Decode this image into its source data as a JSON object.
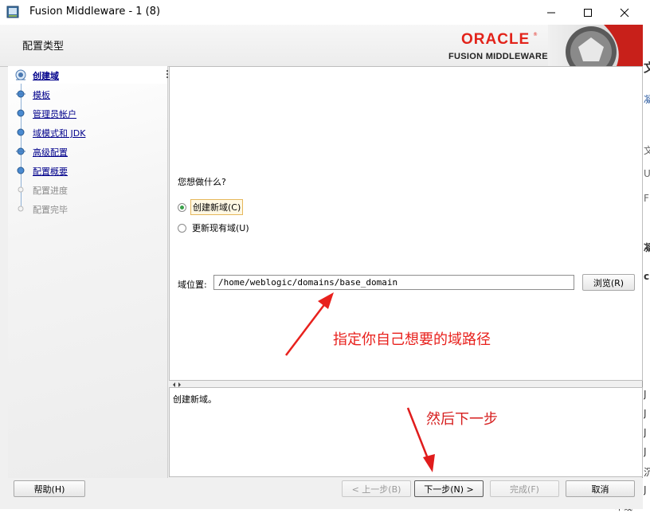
{
  "window": {
    "title": "Fusion Middleware  -  1 (8)"
  },
  "header": {
    "title": "配置类型",
    "brand": "ORACLE",
    "brand_sub": "FUSION MIDDLEWARE",
    "brand_reg": "®"
  },
  "nav": {
    "items": [
      {
        "label": "创建域",
        "state": "active"
      },
      {
        "label": "模板",
        "state": "link"
      },
      {
        "label": "管理员帐户",
        "state": "link"
      },
      {
        "label": "域模式和 JDK",
        "state": "link"
      },
      {
        "label": "高级配置",
        "state": "link"
      },
      {
        "label": "配置概要",
        "state": "link"
      },
      {
        "label": "配置进度",
        "state": "disabled"
      },
      {
        "label": "配置完毕",
        "state": "disabled"
      }
    ]
  },
  "main": {
    "question": "您想做什么?",
    "options": [
      {
        "label": "创建新域(C)",
        "checked": true
      },
      {
        "label": "更新现有域(U)",
        "checked": false
      }
    ],
    "domain_location_label": "域位置:",
    "domain_location_value": "/home/weblogic/domains/base_domain",
    "browse_label": "浏览(R)"
  },
  "description": {
    "text": "创建新域。"
  },
  "footer": {
    "help": "帮助(H)",
    "back": "< 上一步(B)",
    "next": "下一步(N) >",
    "finish": "完成(F)",
    "cancel": "取消"
  },
  "annotations": {
    "domain_path_note": "指定你自己想要的域路径",
    "next_note": "然后下一步"
  },
  "background": {
    "right_edge_chars": [
      "文",
      "凝",
      "文",
      "U",
      "F",
      "凝",
      "c",
      "J",
      "J",
      "J",
      "J",
      "沉",
      "J"
    ],
    "bottom_text": "本线"
  },
  "colors": {
    "oracle_red": "#e2231a",
    "link_blue": "#00008b",
    "annotation_red": "#e8211d",
    "radio_green": "#3aa04a"
  }
}
